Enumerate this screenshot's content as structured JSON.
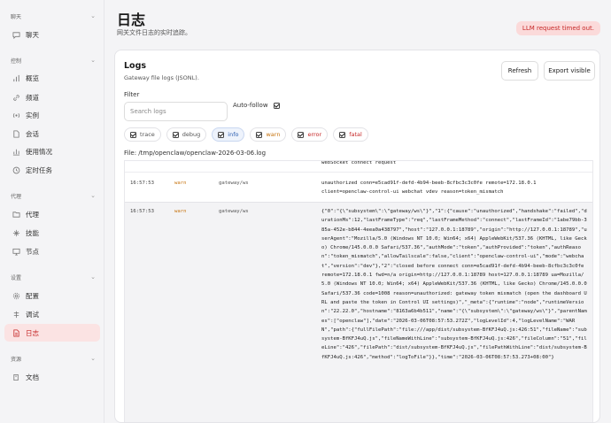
{
  "sidebar": {
    "groups": [
      {
        "label": "聊天",
        "items": [
          {
            "label": "聊天",
            "icon": "chat-icon"
          }
        ]
      },
      {
        "label": "控制",
        "items": [
          {
            "label": "概览",
            "icon": "bar-chart-icon"
          },
          {
            "label": "频道",
            "icon": "link-icon"
          },
          {
            "label": "实例",
            "icon": "radio-icon"
          },
          {
            "label": "会话",
            "icon": "document-icon"
          },
          {
            "label": "使用情况",
            "icon": "stats-icon"
          },
          {
            "label": "定时任务",
            "icon": "clock-icon"
          }
        ]
      },
      {
        "label": "代理",
        "items": [
          {
            "label": "代理",
            "icon": "folder-icon"
          },
          {
            "label": "技能",
            "icon": "sparkle-icon"
          },
          {
            "label": "节点",
            "icon": "monitor-icon"
          }
        ]
      },
      {
        "label": "设置",
        "items": [
          {
            "label": "配置",
            "icon": "gear-icon"
          },
          {
            "label": "调试",
            "icon": "bug-icon"
          },
          {
            "label": "日志",
            "icon": "log-icon",
            "active": true
          }
        ]
      },
      {
        "label": "资源",
        "items": [
          {
            "label": "文档",
            "icon": "book-icon"
          }
        ]
      }
    ]
  },
  "header": {
    "title": "日志",
    "subtitle": "网关文件日志的实时追踪。",
    "toast": "LLM request timed out."
  },
  "card": {
    "title": "Logs",
    "subtitle": "Gateway file logs (JSONL).",
    "refresh_label": "Refresh",
    "export_label": "Export visible",
    "filter_label": "Filter",
    "search_placeholder": "Search logs",
    "autofollow_label": "Auto-follow",
    "levels": [
      "trace",
      "debug",
      "info",
      "warn",
      "error",
      "fatal"
    ],
    "file_path": "File: /tmp/openclaw/openclaw-2026-03-06.log"
  },
  "log_rows": [
    {
      "time": "",
      "level": "",
      "subsystem": "",
      "message": "webSocket connect request"
    },
    {
      "time": "16:57:53",
      "level": "warn",
      "subsystem": "gateway/ws",
      "message": "unauthorized conn=e5cad91f-defd-4b94-beeb-8cfbc3c3c0fe remote=172.18.0.1\nclient=openclaw-control-ui webchat vdev reason=token_mismatch"
    },
    {
      "time": "16:57:53",
      "level": "warn",
      "subsystem": "gateway/ws",
      "message": "{\"0\":\"{\\\"subsystem\\\":\\\"gateway/ws\\\"}\",\"1\":{\"cause\":\"unauthorized\",\"handshake\":\"failed\",\"durationMs\":12,\"lastFrameType\":\"req\",\"lastFrameMethod\":\"connect\",\"lastFrameId\":\"1abe79bb-385a-452e-b844-4eea0a438797\",\"host\":\"127.0.0.1:18789\",\"origin\":\"http://127.0.0.1:18789\",\"userAgent\":\"Mozilla/5.0 (Windows NT 10.0; Win64; x64) AppleWebKit/537.36 (KHTML, like Gecko) Chrome/145.0.0.0 Safari/537.36\",\"authMode\":\"token\",\"authProvided\":\"token\",\"authReason\":\"token_mismatch\",\"allowTailscale\":false,\"client\":\"openclaw-control-ui\",\"mode\":\"webchat\",\"version\":\"dev\"},\"2\":\"closed before connect conn=e5cad91f-defd-4b94-beeb-8cfbc3c3c0fe remote=172.18.0.1 fwd=n/a origin=http://127.0.0.1:18789 host=127.0.0.1:18789 ua=Mozilla/5.0 (Windows NT 10.0; Win64; x64) AppleWebKit/537.36 (KHTML, like Gecko) Chrome/145.0.0.0 Safari/537.36 code=1008 reason=unauthorized: gateway token mismatch (open the dashboard URL and paste the token in Control UI settings)\",\"_meta\":{\"runtime\":\"node\",\"runtimeVersion\":\"22.22.0\",\"hostname\":\"8163a6b4b511\",\"name\":\"{\\\"subsystem\\\":\\\"gateway/ws\\\"}\",\"parentNames\":[\"openclaw\"],\"date\":\"2026-03-06T08:57:53.272Z\",\"logLevelId\":4,\"logLevelName\":\"WARN\",\"path\":{\"fullFilePath\":\"file:///app/dist/subsystem-BfKFJ4uQ.js:426:51\",\"fileName\":\"subsystem-BfKFJ4uQ.js\",\"fileNameWithLine\":\"subsystem-BfKFJ4uQ.js:426\",\"fileColumn\":\"51\",\"fileLine\":\"426\",\"filePath\":\"dist/subsystem-BfKFJ4uQ.js\",\"filePathWithLine\":\"dist/subsystem-BfKFJ4uQ.js:426\",\"method\":\"logToFile\"}},\"time\":\"2026-03-06T08:57:53.273+08:00\"}"
    }
  ],
  "colors": {
    "accent": "#c62828",
    "warn": "#c77410",
    "info": "#2a5db0"
  }
}
